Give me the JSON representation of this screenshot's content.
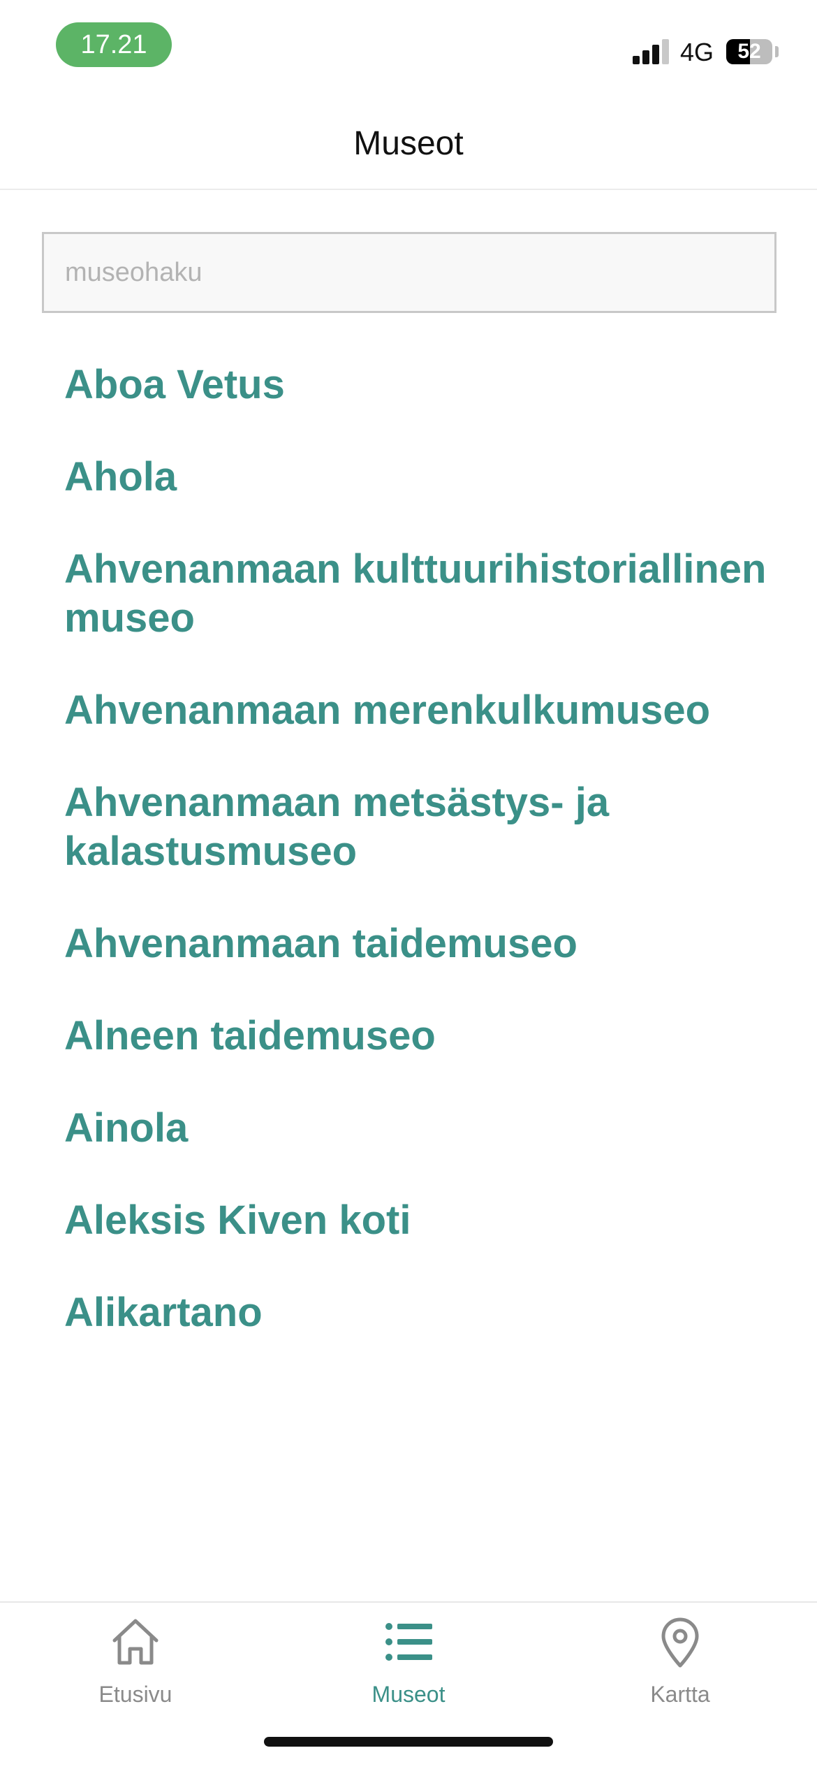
{
  "status_bar": {
    "time": "17.21",
    "network": "4G",
    "battery": "52",
    "battery_fraction": 0.52
  },
  "header": {
    "title": "Museot"
  },
  "search": {
    "placeholder": "museohaku",
    "value": ""
  },
  "museums": [
    "Aboa Vetus",
    "Ahola",
    "Ahvenanmaan kulttuurihistoriallinen museo",
    "Ahvenanmaan merenkulkumuseo",
    "Ahvenanmaan metsästys- ja kalastusmuseo",
    "Ahvenanmaan taidemuseo",
    "Alneen taidemuseo",
    "Ainola",
    "Aleksis Kiven koti",
    "Alikartano"
  ],
  "tabs": [
    {
      "label": "Etusivu",
      "icon": "home-icon",
      "active": false
    },
    {
      "label": "Museot",
      "icon": "list-icon",
      "active": true
    },
    {
      "label": "Kartta",
      "icon": "map-pin-icon",
      "active": false
    }
  ],
  "colors": {
    "accent": "#3b9088",
    "time_pill": "#5cb466",
    "inactive_tab": "#8a8a8a"
  }
}
